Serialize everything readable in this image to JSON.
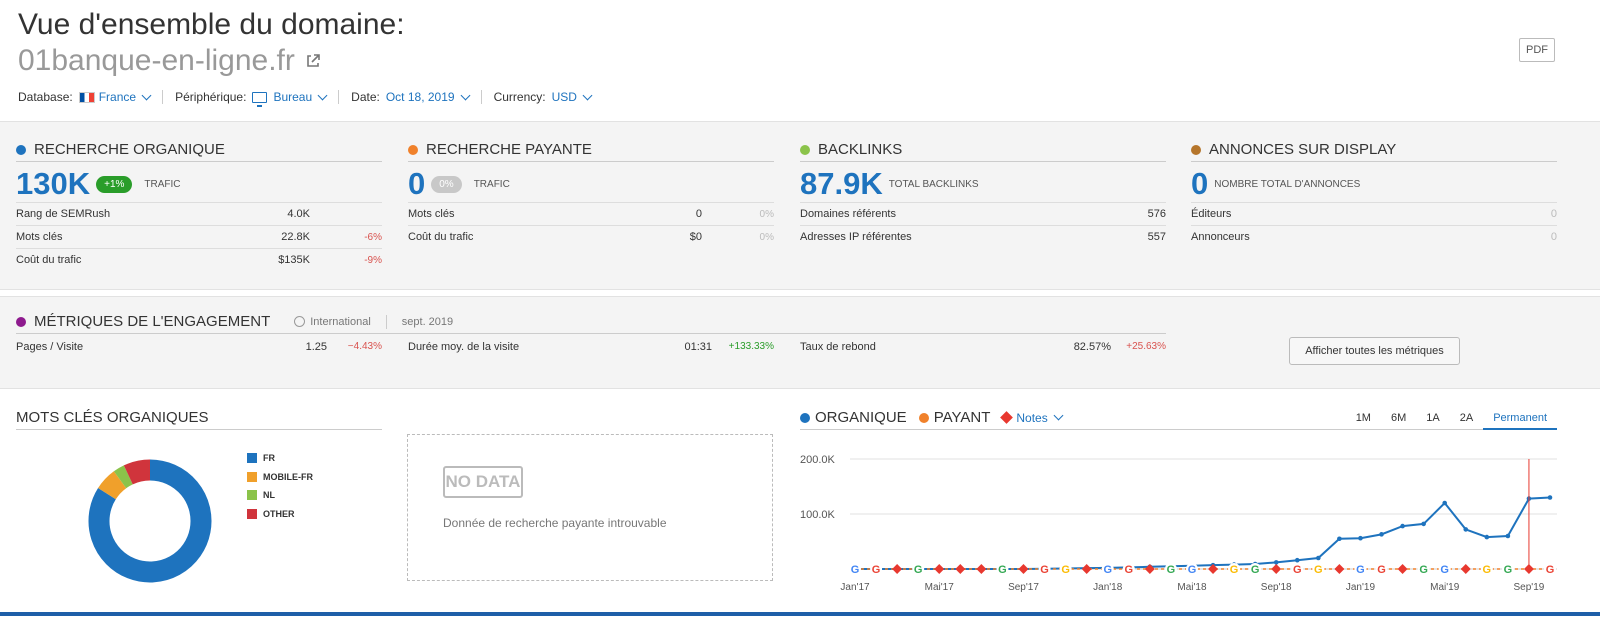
{
  "header": {
    "title": "Vue d'ensemble du domaine:",
    "domain": "01banque-en-ligne.fr",
    "pdf_label": "PDF",
    "filters": {
      "database_label": "Database:",
      "database_value": "France",
      "device_label": "Périphérique:",
      "device_value": "Bureau",
      "date_label": "Date:",
      "date_value": "Oct 18, 2019",
      "currency_label": "Currency:",
      "currency_value": "USD"
    }
  },
  "colors": {
    "organic": "#1e73be",
    "paid": "#f0812b",
    "backlinks": "#8bc34a",
    "display": "#b5752b",
    "engagement": "#8e1a8e",
    "green_badge": "#2a9d2a"
  },
  "organic": {
    "title": "RECHERCHE ORGANIQUE",
    "value": "130K",
    "badge": "+1%",
    "label": "TRAFIC",
    "rows": [
      {
        "k": "Rang de SEMRush",
        "v": "4.0K",
        "d": ""
      },
      {
        "k": "Mots clés",
        "v": "22.8K",
        "d": "-6%"
      },
      {
        "k": "Coût du trafic",
        "v": "$135K",
        "d": "-9%"
      }
    ]
  },
  "paid": {
    "title": "RECHERCHE PAYANTE",
    "value": "0",
    "badge": "0%",
    "label": "TRAFIC",
    "rows": [
      {
        "k": "Mots clés",
        "v": "0",
        "d": "0%"
      },
      {
        "k": "Coût du trafic",
        "v": "$0",
        "d": "0%"
      }
    ]
  },
  "backlinks": {
    "title": "BACKLINKS",
    "value": "87.9K",
    "label": "TOTAL BACKLINKS",
    "rows": [
      {
        "k": "Domaines référents",
        "v": "576"
      },
      {
        "k": "Adresses IP référentes",
        "v": "557"
      }
    ]
  },
  "display": {
    "title": "ANNONCES SUR DISPLAY",
    "value": "0",
    "label": "NOMBRE TOTAL D'ANNONCES",
    "rows": [
      {
        "k": "Éditeurs",
        "v": "0"
      },
      {
        "k": "Annonceurs",
        "v": "0"
      }
    ]
  },
  "engagement": {
    "title": "MÉTRIQUES DE L'ENGAGEMENT",
    "scope": "International",
    "period": "sept. 2019",
    "cells": [
      {
        "k": "Pages / Visite",
        "v": "1.25",
        "d": "−4.43%",
        "pos": false
      },
      {
        "k": "Durée moy. de la visite",
        "v": "01:31",
        "d": "+133.33%",
        "pos": true
      },
      {
        "k": "Taux de rebond",
        "v": "82.57%",
        "d": "+25.63%",
        "pos": false
      }
    ],
    "button": "Afficher toutes les métriques"
  },
  "keywords": {
    "title": "MOTS CLÉS ORGANIQUES",
    "legend": [
      "FR",
      "MOBILE-FR",
      "NL",
      "OTHER"
    ]
  },
  "nodata": {
    "badge": "NO DATA",
    "text": "Donnée de recherche payante introuvable"
  },
  "trend": {
    "organic_label": "ORGANIQUE",
    "paid_label": "PAYANT",
    "notes_label": "Notes",
    "ranges": [
      "1M",
      "6M",
      "1A",
      "2A",
      "Permanent"
    ],
    "active_range": "Permanent"
  },
  "chart_data": [
    {
      "type": "pie",
      "categories": [
        "FR",
        "MOBILE-FR",
        "NL",
        "OTHER"
      ],
      "values": [
        84,
        6,
        3,
        7
      ],
      "colors": [
        "#1e73be",
        "#f0a02b",
        "#8bc34a",
        "#d0343c"
      ]
    },
    {
      "type": "line",
      "x": [
        "Jan'17",
        "Feb'17",
        "Mar'17",
        "Apr'17",
        "Mai'17",
        "Jun'17",
        "Jul'17",
        "Aug'17",
        "Sep'17",
        "Oct'17",
        "Nov'17",
        "Dec'17",
        "Jan'18",
        "Feb'18",
        "Mar'18",
        "Apr'18",
        "Mai'18",
        "Jun'18",
        "Jul'18",
        "Aug'18",
        "Sep'18",
        "Oct'18",
        "Nov'18",
        "Dec'18",
        "Jan'19",
        "Feb'19",
        "Mar'19",
        "Apr'19",
        "Mai'19",
        "Jun'19",
        "Jul'19",
        "Aug'19",
        "Sep'19",
        "Oct'19"
      ],
      "x_tick_labels": [
        "Jan'17",
        "Mai'17",
        "Sep'17",
        "Jan'18",
        "Mai'18",
        "Sep'18",
        "Jan'19",
        "Mai'19",
        "Sep'19"
      ],
      "series": [
        {
          "name": "ORGANIQUE",
          "values": [
            0,
            0,
            0,
            0,
            0,
            0,
            0,
            0,
            0,
            500,
            1000,
            1500,
            2000,
            3000,
            4000,
            5000,
            6000,
            7000,
            8000,
            9000,
            12000,
            16000,
            20000,
            55000,
            56000,
            63000,
            78000,
            82000,
            120000,
            72000,
            58000,
            60000,
            128000,
            130000
          ]
        },
        {
          "name": "PAYANT",
          "values": [
            0,
            0,
            0,
            0,
            0,
            0,
            0,
            0,
            0,
            0,
            0,
            0,
            0,
            0,
            0,
            0,
            0,
            0,
            0,
            0,
            0,
            0,
            0,
            0,
            0,
            0,
            0,
            0,
            0,
            0,
            0,
            0,
            0,
            0
          ]
        }
      ],
      "y_ticks": [
        "100.0K",
        "200.0K"
      ],
      "ylim": [
        0,
        200000
      ]
    }
  ]
}
